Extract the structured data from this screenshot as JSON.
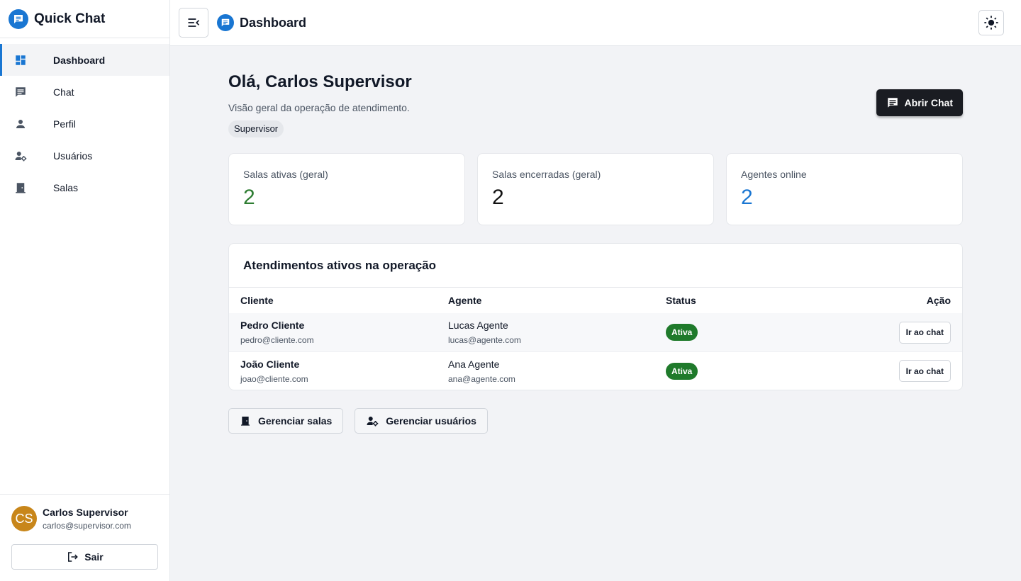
{
  "app": {
    "name": "Quick Chat",
    "page_title": "Dashboard",
    "accent": "#1976d2"
  },
  "sidebar": {
    "items": [
      {
        "label": "Dashboard",
        "icon": "dashboard-icon",
        "active": true
      },
      {
        "label": "Chat",
        "icon": "chat-icon",
        "active": false
      },
      {
        "label": "Perfil",
        "icon": "person-icon",
        "active": false
      },
      {
        "label": "Usuários",
        "icon": "manage-accounts-icon",
        "active": false
      },
      {
        "label": "Salas",
        "icon": "door-icon",
        "active": false
      }
    ],
    "user": {
      "initials": "CS",
      "name": "Carlos Supervisor",
      "email": "carlos@supervisor.com",
      "avatar_color": "#c8861a"
    },
    "logout_label": "Sair"
  },
  "main": {
    "greeting": "Olá, Carlos Supervisor",
    "subtitle": "Visão geral da operação de atendimento.",
    "role": "Supervisor",
    "open_chat_label": "Abrir Chat",
    "stats": [
      {
        "label": "Salas ativas (geral)",
        "value": "2",
        "color": "#2e7d32"
      },
      {
        "label": "Salas encerradas (geral)",
        "value": "2",
        "color": "#111111"
      },
      {
        "label": "Agentes online",
        "value": "2",
        "color": "#1976d2"
      }
    ],
    "table": {
      "title": "Atendimentos ativos na operação",
      "headers": {
        "client": "Cliente",
        "agent": "Agente",
        "status": "Status",
        "action": "Ação"
      },
      "rows": [
        {
          "client_name": "Pedro Cliente",
          "client_email": "pedro@cliente.com",
          "agent_name": "Lucas Agente",
          "agent_email": "lucas@agente.com",
          "status": "Ativa",
          "action": "Ir ao chat"
        },
        {
          "client_name": "João Cliente",
          "client_email": "joao@cliente.com",
          "agent_name": "Ana Agente",
          "agent_email": "ana@agente.com",
          "status": "Ativa",
          "action": "Ir ao chat"
        }
      ]
    },
    "actions": {
      "rooms_label": "Gerenciar salas",
      "users_label": "Gerenciar usuários"
    }
  }
}
